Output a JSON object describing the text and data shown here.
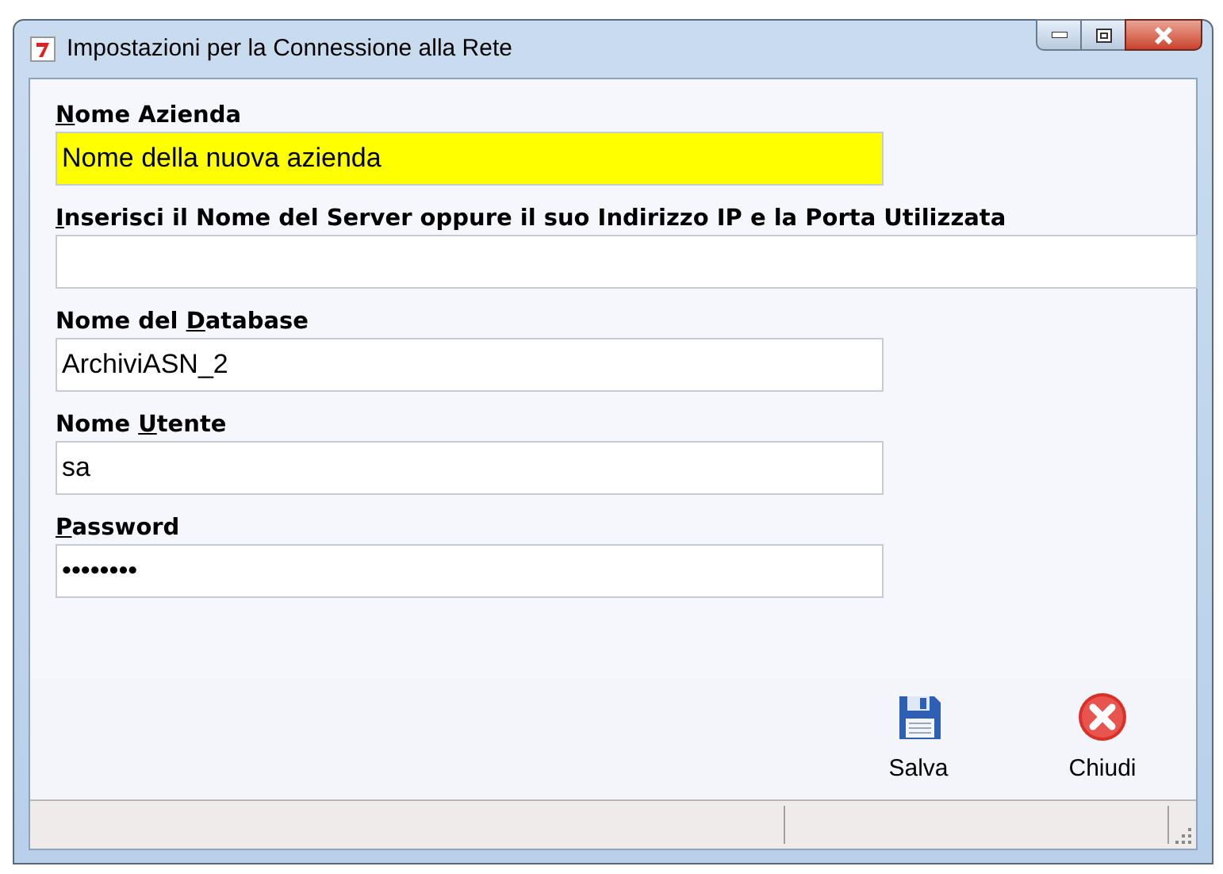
{
  "window": {
    "title": "Impostazioni per la Connessione alla Rete"
  },
  "fields": [
    {
      "access_key": "N",
      "label_after": "ome Azienda",
      "value": "Nome della nuova azienda",
      "highlighted": true,
      "wide": false
    },
    {
      "access_key": "I",
      "label_after": "nserisci il Nome del Server oppure il suo Indirizzo IP e la Porta Utilizzata",
      "highlighted": false,
      "wide": true
    },
    {
      "label_before": "Nome del ",
      "access_key": "D",
      "label_after": "atabase",
      "value": "ArchiviASN_2",
      "highlighted": false,
      "wide": false
    },
    {
      "label_before": "Nome ",
      "access_key": "U",
      "label_after": "tente",
      "value": "sa",
      "highlighted": false,
      "wide": false
    },
    {
      "access_key": "P",
      "label_after": "assword",
      "value": "••••••••",
      "highlighted": false,
      "wide": false
    }
  ],
  "buttons": [
    {
      "kind": "save",
      "label": "Salva"
    },
    {
      "kind": "close",
      "label": "Chiudi"
    }
  ]
}
